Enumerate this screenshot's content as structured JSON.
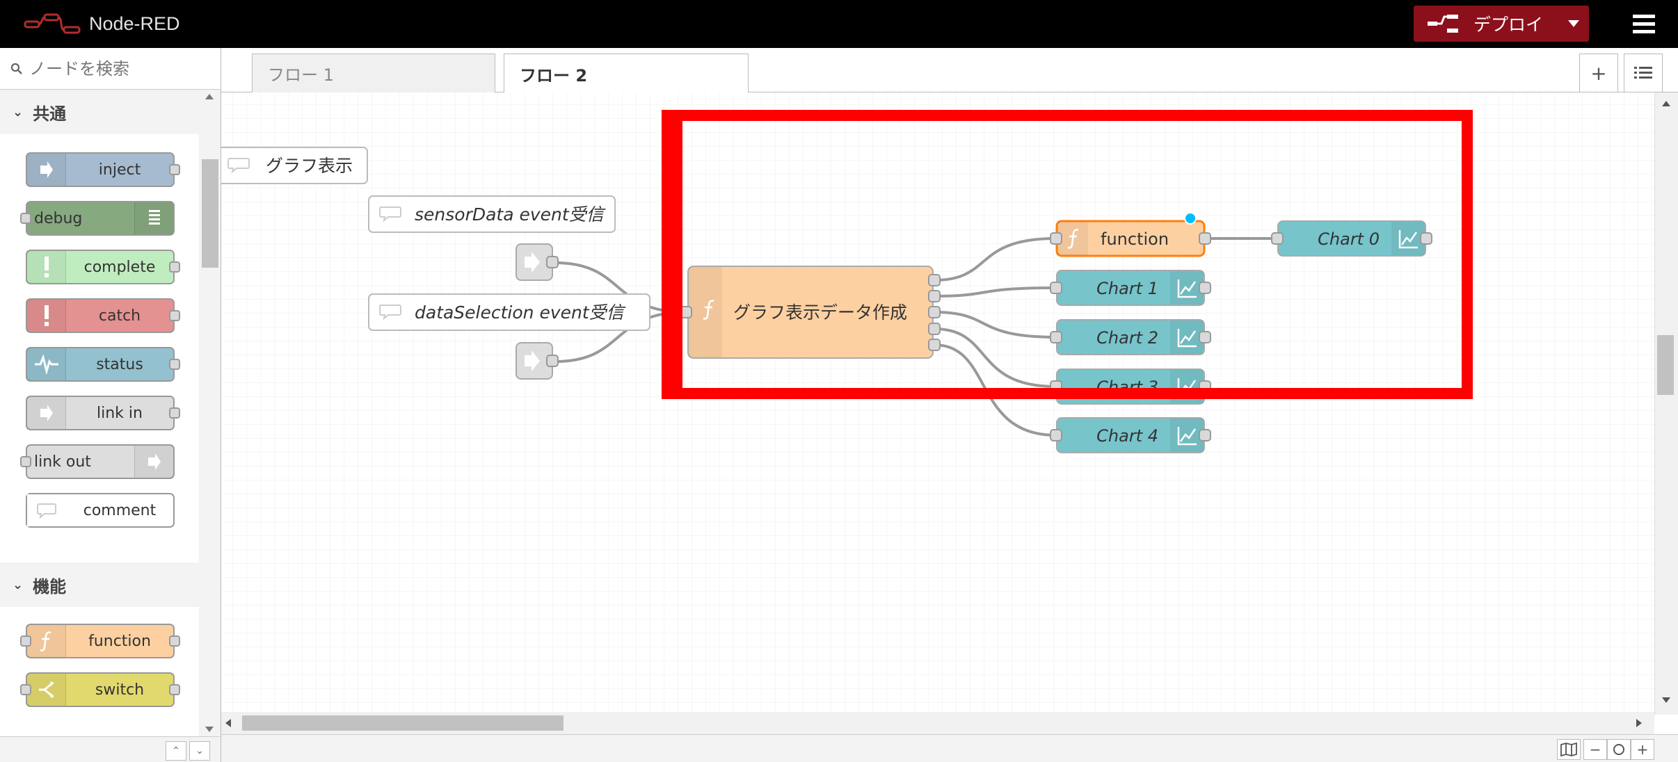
{
  "app": {
    "name": "Node-RED"
  },
  "header": {
    "deploy_label": "デプロイ"
  },
  "palette": {
    "search_placeholder": "ノードを検索",
    "categories": [
      {
        "label": "共通",
        "nodes": [
          "inject",
          "debug",
          "complete",
          "catch",
          "status",
          "link in",
          "link out",
          "comment"
        ]
      },
      {
        "label": "機能",
        "nodes": [
          "function",
          "switch"
        ]
      }
    ]
  },
  "tabs": [
    {
      "label": "フロー 1",
      "active": false
    },
    {
      "label": "フロー 2",
      "active": true
    }
  ],
  "flow": {
    "comments": [
      "グラフ表示",
      "sensorData event受信",
      "dataSelection event受信"
    ],
    "main_function": "グラフ表示データ作成",
    "function_node": "function",
    "charts": [
      "Chart 0",
      "Chart 1",
      "Chart 2",
      "Chart 3",
      "Chart 4"
    ]
  },
  "colors": {
    "header_bg": "#000000",
    "deploy_bg": "#8c101c",
    "function_node": "#fdd0a2",
    "chart_node": "#77c4cb",
    "highlight": "#ff0000",
    "selected_border": "#ff7f0e",
    "changed_dot": "#00bcff"
  }
}
